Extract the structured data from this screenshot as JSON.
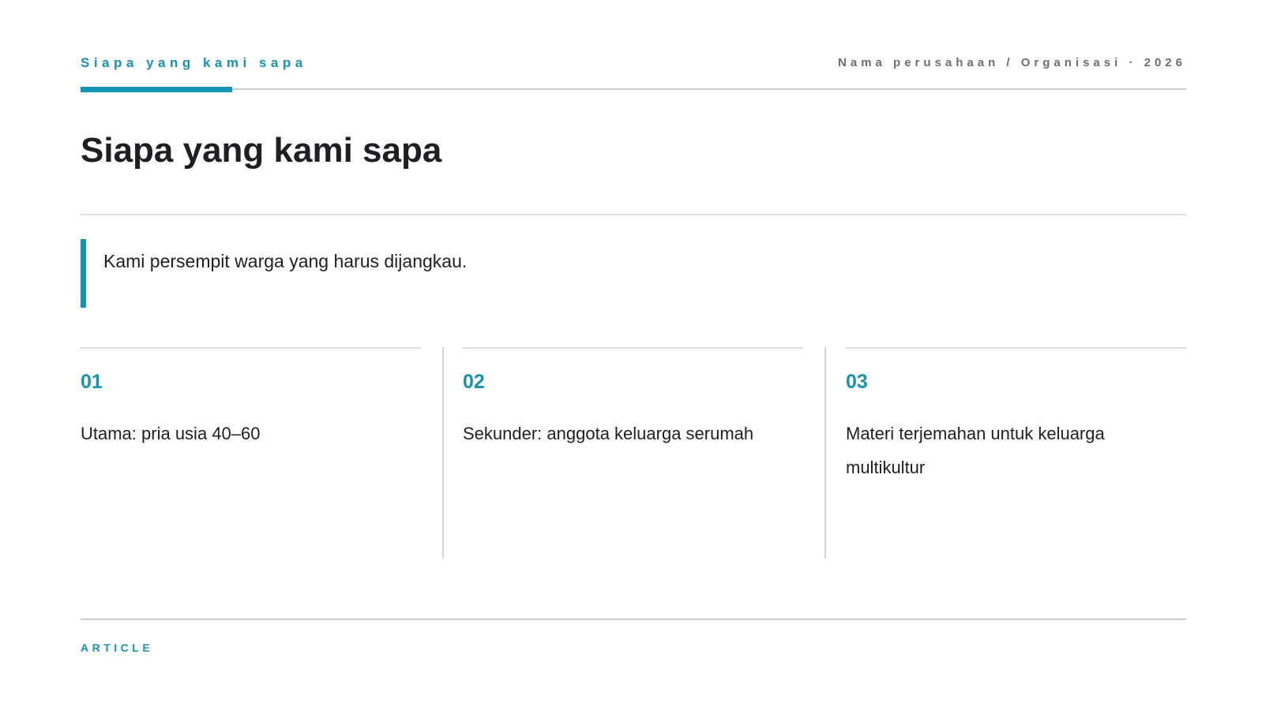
{
  "header": {
    "section_label": "Siapa yang kami sapa",
    "organization": "Nama perusahaan / Organisasi · 2026"
  },
  "title": "Siapa yang kami sapa",
  "quote": "Kami persempit warga yang harus dijangkau.",
  "columns": [
    {
      "number": "01",
      "text": "Utama: pria usia 40–60"
    },
    {
      "number": "02",
      "text": "Sekunder: anggota keluarga serumah"
    },
    {
      "number": "03",
      "text": "Materi terjemahan untuk keluarga multikultur"
    }
  ],
  "footer": {
    "label": "ARTICLE"
  },
  "colors": {
    "accent": "#1592b4",
    "text": "#1e1f22",
    "muted": "#6b6e73",
    "rule": "#dcdde0"
  }
}
